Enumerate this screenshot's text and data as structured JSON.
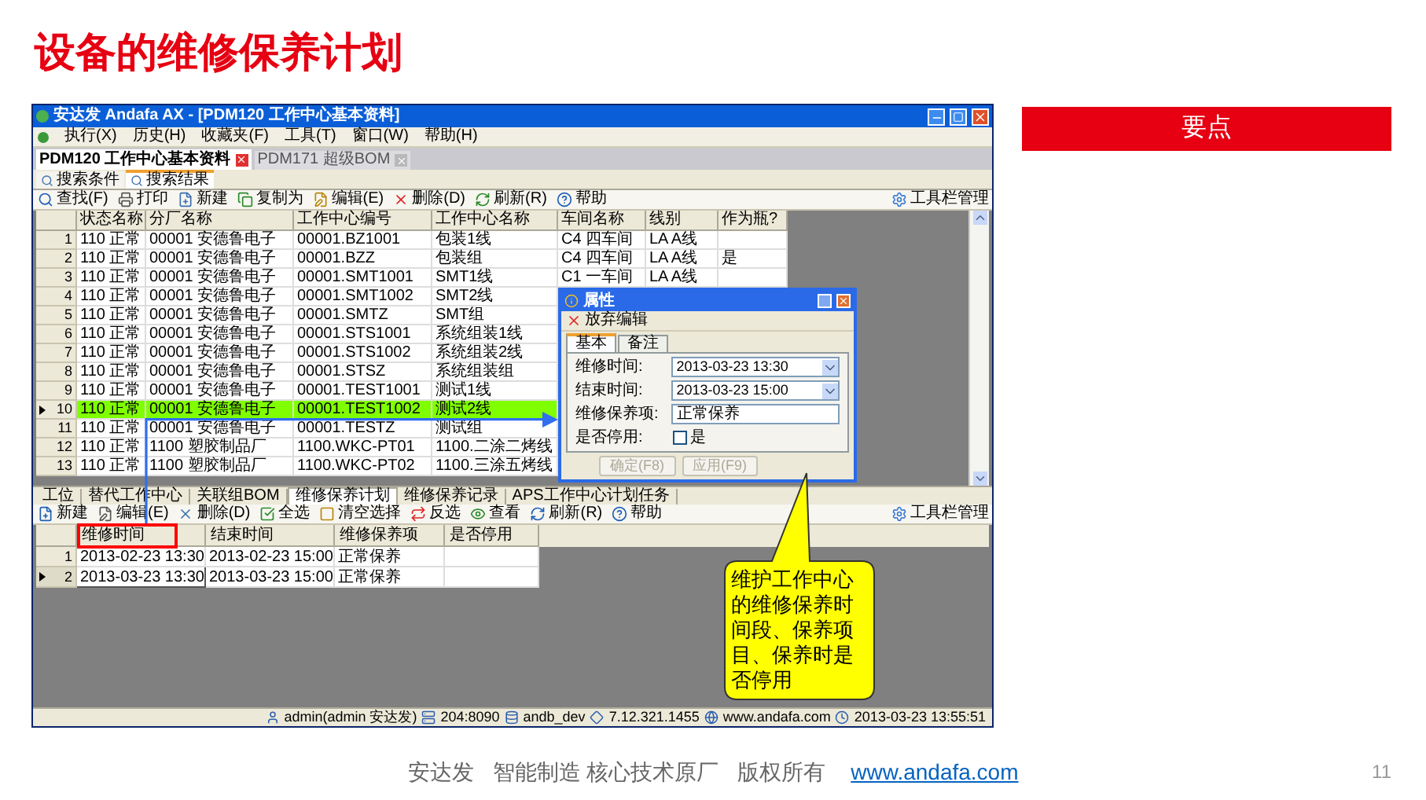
{
  "slide": {
    "title": "设备的维修保养计划",
    "key_points": "要点",
    "page_number": "11"
  },
  "window": {
    "title": "安达发 Andafa AX - [PDM120 工作中心基本资料]",
    "menu": [
      "执行(X)",
      "历史(H)",
      "收藏夹(F)",
      "工具(T)",
      "窗口(W)",
      "帮助(H)"
    ],
    "doc_tabs": [
      {
        "label": "PDM120 工作中心基本资料",
        "selected": true
      },
      {
        "label": "PDM171 超级BOM",
        "selected": false
      }
    ],
    "search_tabs": [
      {
        "label": "搜索条件",
        "selected": false
      },
      {
        "label": "搜索结果",
        "selected": true
      }
    ],
    "toolbar": [
      "查找(F)",
      "打印",
      "新建",
      "复制为",
      "编辑(E)",
      "删除(D)",
      "刷新(R)",
      "帮助"
    ],
    "toolbar_manager": "工具栏管理",
    "table": {
      "columns": [
        "状态名称",
        "分厂名称",
        "工作中心编号",
        "工作中心名称",
        "车间名称",
        "线别",
        "作为瓶?"
      ],
      "rows": [
        {
          "number": "1",
          "selected": false,
          "cells": [
            "110 正常",
            "00001 安德鲁电子",
            "00001.BZ1001",
            "包装1线",
            "C4 四车间",
            "LA A线",
            ""
          ]
        },
        {
          "number": "2",
          "selected": false,
          "cells": [
            "110 正常",
            "00001 安德鲁电子",
            "00001.BZZ",
            "包装组",
            "C4 四车间",
            "LA A线",
            "是"
          ]
        },
        {
          "number": "3",
          "selected": false,
          "cells": [
            "110 正常",
            "00001 安德鲁电子",
            "00001.SMT1001",
            "SMT1线",
            "C1 一车间",
            "LA A线",
            ""
          ]
        },
        {
          "number": "4",
          "selected": false,
          "cells": [
            "110 正常",
            "00001 安德鲁电子",
            "00001.SMT1002",
            "SMT2线"
          ]
        },
        {
          "number": "5",
          "selected": false,
          "cells": [
            "110 正常",
            "00001 安德鲁电子",
            "00001.SMTZ",
            "SMT组"
          ]
        },
        {
          "number": "6",
          "selected": false,
          "cells": [
            "110 正常",
            "00001 安德鲁电子",
            "00001.STS1001",
            "系统组装1线"
          ]
        },
        {
          "number": "7",
          "selected": false,
          "cells": [
            "110 正常",
            "00001 安德鲁电子",
            "00001.STS1002",
            "系统组装2线"
          ]
        },
        {
          "number": "8",
          "selected": false,
          "cells": [
            "110 正常",
            "00001 安德鲁电子",
            "00001.STSZ",
            "系统组装组"
          ]
        },
        {
          "number": "9",
          "selected": false,
          "cells": [
            "110 正常",
            "00001 安德鲁电子",
            "00001.TEST1001",
            "测试1线"
          ]
        },
        {
          "number": "10",
          "selected": true,
          "cells": [
            "110 正常",
            "00001 安德鲁电子",
            "00001.TEST1002",
            "测试2线"
          ]
        },
        {
          "number": "11",
          "selected": false,
          "cells": [
            "110 正常",
            "00001 安德鲁电子",
            "00001.TESTZ",
            "测试组"
          ]
        },
        {
          "number": "12",
          "selected": false,
          "cells": [
            "110 正常",
            "1100 塑胶制品厂",
            "1100.WKC-PT01",
            "1100.二涂二烤线"
          ]
        },
        {
          "number": "13",
          "selected": false,
          "cells": [
            "110 正常",
            "1100 塑胶制品厂",
            "1100.WKC-PT02",
            "1100.三涂五烤线"
          ]
        }
      ]
    },
    "detail_tabs": [
      {
        "label": "工位",
        "selected": false
      },
      {
        "label": "替代工作中心",
        "selected": false
      },
      {
        "label": "关联组BOM",
        "selected": false
      },
      {
        "label": "维修保养计划",
        "selected": true
      },
      {
        "label": "维修保养记录",
        "selected": false
      },
      {
        "label": "APS工作中心计划任务",
        "selected": false
      }
    ],
    "detail_toolbar": [
      "新建",
      "编辑(E)",
      "删除(D)",
      "全选",
      "清空选择",
      "反选",
      "查看",
      "刷新(R)",
      "帮助"
    ],
    "detail_toolbar_manager": "工具栏管理",
    "detail_table": {
      "columns": [
        "维修时间",
        "结束时间",
        "维修保养项",
        "是否停用"
      ],
      "rows": [
        {
          "number": "1",
          "selected": false,
          "cells": [
            "2013-02-23 13:30",
            "2013-02-23 15:00",
            "正常保养",
            ""
          ]
        },
        {
          "number": "2",
          "selected": true,
          "cells": [
            "2013-03-23 13:30",
            "2013-03-23 15:00",
            "正常保养",
            ""
          ]
        }
      ]
    },
    "status_bar": [
      "admin(admin 安达发)",
      "204:8090",
      "andb_dev",
      "7.12.321.1455",
      "www.andafa.com",
      "2013-03-23 13:55:51"
    ]
  },
  "dialog": {
    "title": "属性",
    "toolbar": "放弃编辑",
    "tabs": [
      {
        "label": "基本",
        "selected": true
      },
      {
        "label": "备注",
        "selected": false
      }
    ],
    "fields": [
      {
        "kind": "dropdown",
        "label": "维修时间:",
        "value": "2013-03-23 13:30"
      },
      {
        "kind": "dropdown",
        "label": "结束时间:",
        "value": "2013-03-23 15:00"
      },
      {
        "kind": "text",
        "label": "维修保养项:",
        "value": "正常保养"
      },
      {
        "kind": "checkbox",
        "label": "是否停用:",
        "option": "是",
        "checked": false
      }
    ],
    "buttons": [
      {
        "label": "确定(F8)",
        "disabled": true
      },
      {
        "label": "应用(F9)",
        "disabled": true
      }
    ]
  },
  "callout": "维护工作中心的维修保养时间段、保养项目、保养时是否停用",
  "footer": [
    {
      "kind": "text",
      "text": "安达发"
    },
    {
      "kind": "text",
      "text": "智能制造 核心技术原厂"
    },
    {
      "kind": "text",
      "text": "版权所有"
    },
    {
      "kind": "link",
      "text": "www.andafa.com"
    }
  ]
}
